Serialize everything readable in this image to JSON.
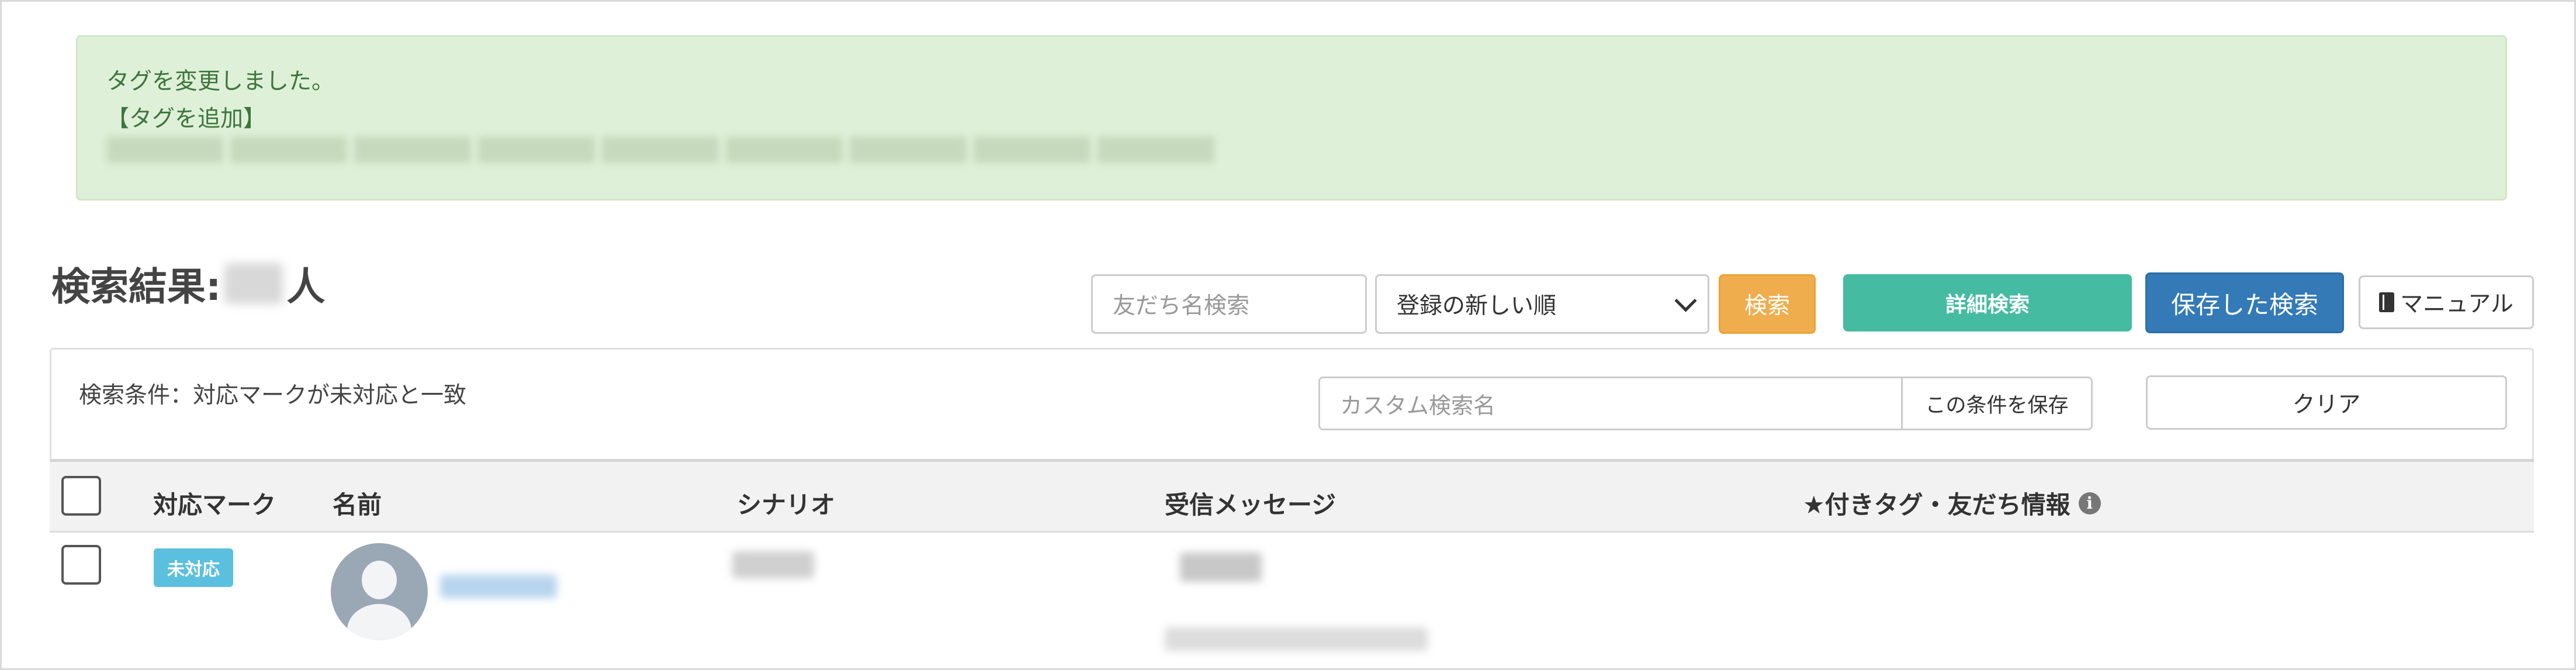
{
  "alert": {
    "line1": "タグを変更しました。",
    "line2": "【タグを追加】"
  },
  "results": {
    "prefix": "検索結果:",
    "suffix": "人"
  },
  "toolbar": {
    "search_placeholder": "友だち名検索",
    "sort_selected": "登録の新しい順",
    "search_label": "検索",
    "detail_search_label": "詳細検索",
    "saved_search_label": "保存した検索",
    "manual_label": "マニュアル"
  },
  "conditions": {
    "text": "検索条件：対応マークが未対応と一致",
    "custom_name_placeholder": "カスタム検索名",
    "save_label": "この条件を保存",
    "clear_label": "クリア"
  },
  "table": {
    "headers": {
      "status": "対応マーク",
      "name": "名前",
      "scenario": "シナリオ",
      "message": "受信メッセージ",
      "tags": "★付きタグ・友だち情報"
    },
    "rows": [
      {
        "status_badge": "未対応"
      }
    ]
  },
  "colors": {
    "alert_bg": "#dff0d8",
    "alert_text": "#3c763d",
    "search_btn": "#f0ad4e",
    "detail_btn": "#45bba1",
    "saved_btn": "#337ab7",
    "status_badge": "#5bc0de"
  },
  "icons": [
    "book-icon",
    "info-icon",
    "chevron-down-icon",
    "avatar-placeholder-icon"
  ]
}
